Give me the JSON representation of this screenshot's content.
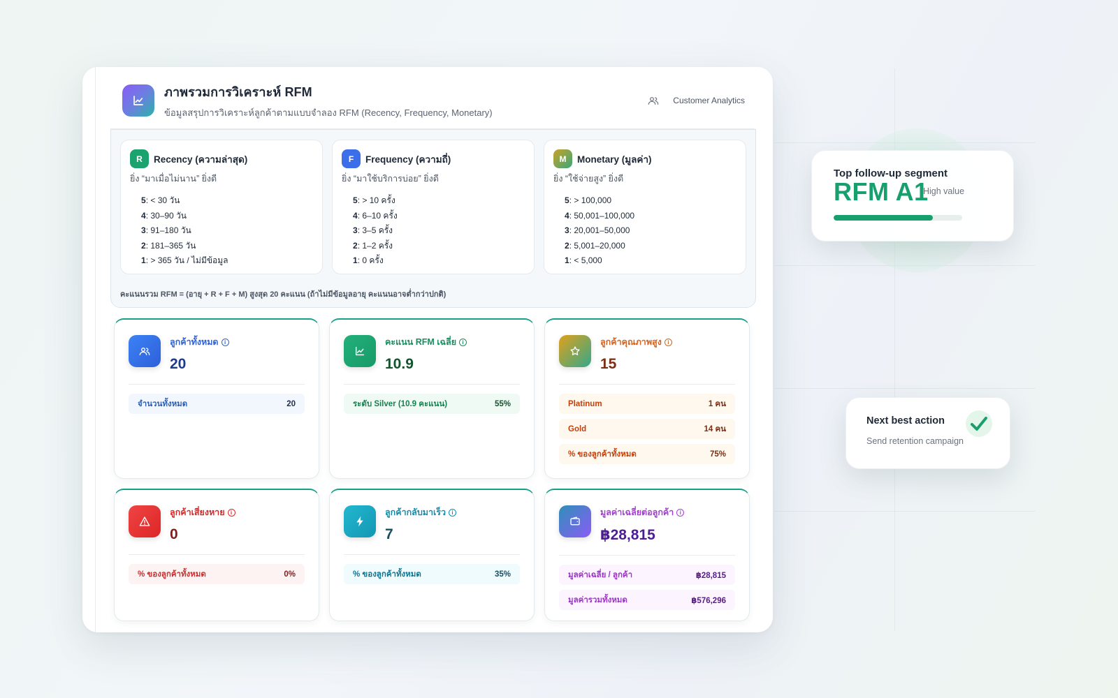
{
  "header": {
    "title": "ภาพรวมการวิเคราะห์ RFM",
    "subtitle": "ข้อมูลสรุปการวิเคราะห์ลูกค้าตามแบบจำลอง RFM (Recency, Frequency, Monetary)",
    "right_label": "Customer Analytics"
  },
  "rfm": {
    "recency": {
      "badge": "R",
      "name": "Recency (ความล่าสุด)",
      "desc": "ยิ่ง “มาเมื่อไม่นาน” ยิ่งดี",
      "levels": [
        {
          "score": "5",
          "text": ": < 30 วัน"
        },
        {
          "score": "4",
          "text": ": 30–90 วัน"
        },
        {
          "score": "3",
          "text": ": 91–180 วัน"
        },
        {
          "score": "2",
          "text": ": 181–365 วัน"
        },
        {
          "score": "1",
          "text": ": > 365 วัน / ไม่มีข้อมูล"
        }
      ]
    },
    "frequency": {
      "badge": "F",
      "name": "Frequency (ความถี่)",
      "desc": "ยิ่ง “มาใช้บริการบ่อย” ยิ่งดี",
      "levels": [
        {
          "score": "5",
          "text": ": > 10 ครั้ง"
        },
        {
          "score": "4",
          "text": ": 6–10 ครั้ง"
        },
        {
          "score": "3",
          "text": ": 3–5 ครั้ง"
        },
        {
          "score": "2",
          "text": ": 1–2 ครั้ง"
        },
        {
          "score": "1",
          "text": ": 0 ครั้ง"
        }
      ]
    },
    "monetary": {
      "badge": "M",
      "name": "Monetary (มูลค่า)",
      "desc": "ยิ่ง “ใช้จ่ายสูง” ยิ่งดี",
      "levels": [
        {
          "score": "5",
          "text": ": > 100,000"
        },
        {
          "score": "4",
          "text": ": 50,001–100,000"
        },
        {
          "score": "3",
          "text": ": 20,001–50,000"
        },
        {
          "score": "2",
          "text": ": 5,001–20,000"
        },
        {
          "score": "1",
          "text": ": < 5,000"
        }
      ]
    },
    "note": "คะแนนรวม RFM = (อายุ + R + F + M) สูงสุด 20 คะแนน (ถ้าไม่มีข้อมูลอายุ คะแนนอาจต่ำกว่าปกติ)"
  },
  "stats": {
    "total": {
      "label": "ลูกค้าทั้งหมด",
      "value": "20",
      "rows": [
        {
          "label": "จำนวนทั้งหมด",
          "value": "20"
        }
      ]
    },
    "avg_score": {
      "label": "คะแนน RFM เฉลี่ย",
      "value": "10.9",
      "rows": [
        {
          "label": "ระดับ Silver (10.9 คะแนน)",
          "value": "55%"
        }
      ]
    },
    "quality": {
      "label": "ลูกค้าคุณภาพสูง",
      "value": "15",
      "rows": [
        {
          "label": "Platinum",
          "value": "1 คน"
        },
        {
          "label": "Gold",
          "value": "14 คน"
        },
        {
          "label": "% ของลูกค้าทั้งหมด",
          "value": "75%"
        }
      ]
    },
    "churn": {
      "label": "ลูกค้าเสี่ยงหาย",
      "value": "0",
      "rows": [
        {
          "label": "% ของลูกค้าทั้งหมด",
          "value": "0%"
        }
      ]
    },
    "returning": {
      "label": "ลูกค้ากลับมาเร็ว",
      "value": "7",
      "rows": [
        {
          "label": "% ของลูกค้าทั้งหมด",
          "value": "35%"
        }
      ]
    },
    "avg_value": {
      "label": "มูลค่าเฉลี่ยต่อลูกค้า",
      "value": "฿28,815",
      "rows": [
        {
          "label": "มูลค่าเฉลี่ย / ลูกค้า",
          "value": "฿28,815"
        },
        {
          "label": "มูลค่ารวมทั้งหมด",
          "value": "฿576,296"
        }
      ]
    }
  },
  "segment_card": {
    "kicker": "Top follow-up segment",
    "segment": "RFM A1",
    "tag": "High value",
    "progress": 0.77
  },
  "action_card": {
    "title": "Next best action",
    "subtitle": "Send retention campaign"
  },
  "colors": {
    "accent_green": "#17a06e",
    "teal_top": "#14a089"
  }
}
